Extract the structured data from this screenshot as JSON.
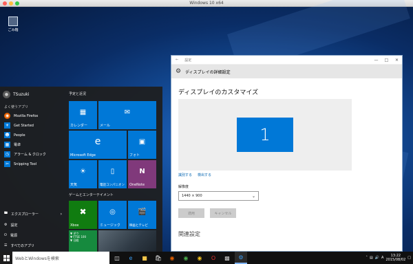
{
  "mac_window": {
    "title": "Windows 10 x64"
  },
  "desktop": {
    "recycle_bin_label": "ごみ箱"
  },
  "start_menu": {
    "user": "TSuzuki",
    "most_used_label": "よく使うアプリ",
    "apps": [
      {
        "label": "Mozilla Firefox",
        "icon": "firefox-icon",
        "color": "#e66000"
      },
      {
        "label": "Get Started",
        "icon": "lightbulb-icon",
        "color": "#0078d7"
      },
      {
        "label": "People",
        "icon": "people-icon",
        "color": "#0078d7"
      },
      {
        "label": "電卓",
        "icon": "calculator-icon",
        "color": "#0078d7"
      },
      {
        "label": "アラーム & クロック",
        "icon": "alarm-icon",
        "color": "#0078d7"
      },
      {
        "label": "Snipping Tool",
        "icon": "scissors-icon",
        "color": "#0078d7"
      }
    ],
    "bottom": [
      {
        "label": "エクスプローラー",
        "icon": "folder-icon",
        "chevron": "›"
      },
      {
        "label": "設定",
        "icon": "gear-icon",
        "chevron": ""
      },
      {
        "label": "電源",
        "icon": "power-icon",
        "chevron": ""
      },
      {
        "label": "すべてのアプリ",
        "icon": "list-icon",
        "chevron": ""
      }
    ],
    "group1_label": "予定と近況",
    "group2_label": "ゲームとエンターテイメント",
    "tiles": {
      "calendar": "カレンダー",
      "mail": "メール",
      "edge": "Microsoft Edge",
      "photos": "フォト",
      "weather": "天気",
      "phone_companion": "電話コンパニオン",
      "onenote": "OneNote",
      "xbox": "Xbox",
      "groove": "ミュージック",
      "movies": "映画とテレビ",
      "news_line1": "▼ ダウ",
      "news_line2": "▼ FTSE 100",
      "news_line3": "▼ 日経"
    },
    "colors": {
      "tile_blue": "#0078d7",
      "onenote": "#80397b",
      "xbox": "#107c10",
      "money": "#168a3e"
    }
  },
  "settings": {
    "window_title": "設定",
    "header": "ディスプレイの詳細設定",
    "section_title": "ディスプレイのカスタマイズ",
    "monitor_number": "1",
    "identify_link": "識別する",
    "detect_link": "検出する",
    "resolution_label": "解像度",
    "resolution_value": "1440 × 900",
    "apply_button": "適用",
    "cancel_button": "キャンセル",
    "related_title": "関連設定"
  },
  "taskbar": {
    "search_placeholder": "WebとWindowsを検索",
    "time": "13:22",
    "date": "2015/08/02"
  }
}
